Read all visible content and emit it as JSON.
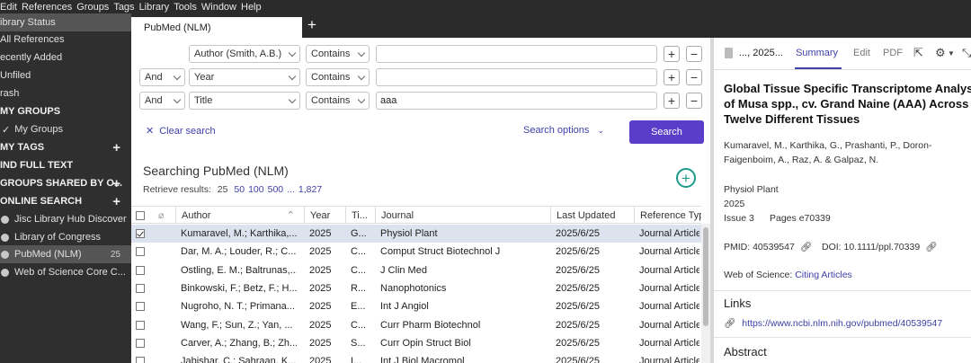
{
  "menu": [
    "Edit",
    "References",
    "Groups",
    "Tags",
    "Library",
    "Tools",
    "Window",
    "Help"
  ],
  "sidebar": {
    "items": [
      {
        "label": "Library Status",
        "display": "ibrary Status",
        "type": "item",
        "selected": true
      },
      {
        "label": "All References",
        "display": "All References",
        "type": "item"
      },
      {
        "label": "Recently Added",
        "display": "ecently Added",
        "type": "item"
      },
      {
        "label": "Unfiled",
        "display": "Unfiled",
        "type": "item"
      },
      {
        "label": "Trash",
        "display": "rash",
        "type": "item"
      },
      {
        "label": "MY GROUPS",
        "display": "MY GROUPS",
        "type": "header"
      },
      {
        "label": "My Groups",
        "display": "My Groups",
        "type": "subitem"
      },
      {
        "label": "MY TAGS",
        "display": "MY TAGS",
        "type": "header",
        "plus": true
      },
      {
        "label": "FIND FULL TEXT",
        "display": "IND FULL TEXT",
        "type": "header"
      },
      {
        "label": "GROUPS SHARED BY O...",
        "display": "GROUPS SHARED BY O...",
        "type": "header",
        "plus": true
      },
      {
        "label": "ONLINE SEARCH",
        "display": "ONLINE SEARCH",
        "type": "header",
        "plus": true
      },
      {
        "label": "Jisc Library Hub Discover",
        "display": "Jisc Library Hub Discover",
        "type": "online"
      },
      {
        "label": "Library of Congress",
        "display": "Library of Congress",
        "type": "online"
      },
      {
        "label": "PubMed (NLM)",
        "display": "PubMed (NLM)",
        "type": "online",
        "count": "25",
        "selected": true
      },
      {
        "label": "Web of Science Core C...",
        "display": "Web of Science Core C...",
        "type": "online"
      }
    ]
  },
  "tabs": {
    "active": "PubMed (NLM)",
    "add": "+"
  },
  "search": {
    "rows": [
      {
        "bool": "",
        "field": "Author (Smith, A.B.)",
        "op": "Contains",
        "value": ""
      },
      {
        "bool": "And",
        "field": "Year",
        "op": "Contains",
        "value": ""
      },
      {
        "bool": "And",
        "field": "Title",
        "op": "Contains",
        "value": "aaa"
      }
    ],
    "clear_label": "Clear search",
    "options_label": "Search options",
    "search_label": "Search"
  },
  "results": {
    "heading": "Searching PubMed (NLM)",
    "retrieve_label": "Retrieve results:",
    "current": "25",
    "options": [
      "50",
      "100",
      "500",
      "...",
      "1,827"
    ]
  },
  "table": {
    "columns": [
      "Author",
      "Year",
      "Ti...",
      "Journal",
      "Last Updated",
      "Reference Typ"
    ],
    "rows": [
      {
        "author": "Kumaravel, M.; Karthika,...",
        "year": "2025",
        "title": "G...",
        "journal": "Physiol Plant",
        "updated": "2025/6/25",
        "type": "Journal Article",
        "checked": true
      },
      {
        "author": "Dar, M. A.; Louder, R.; C...",
        "year": "2025",
        "title": "C...",
        "journal": "Comput Struct Biotechnol J",
        "updated": "2025/6/25",
        "type": "Journal Article"
      },
      {
        "author": "Ostling, E. M.; Baltrunas,...",
        "year": "2025",
        "title": "C...",
        "journal": "J Clin Med",
        "updated": "2025/6/25",
        "type": "Journal Article"
      },
      {
        "author": "Binkowski, F.; Betz, F.; H...",
        "year": "2025",
        "title": "R...",
        "journal": "Nanophotonics",
        "updated": "2025/6/25",
        "type": "Journal Article"
      },
      {
        "author": "Nugroho, N. T.; Primana...",
        "year": "2025",
        "title": "E...",
        "journal": "Int J Angiol",
        "updated": "2025/6/25",
        "type": "Journal Article"
      },
      {
        "author": "Wang, F.; Sun, Z.; Yan, ...",
        "year": "2025",
        "title": "C...",
        "journal": "Curr Pharm Biotechnol",
        "updated": "2025/6/25",
        "type": "Journal Article"
      },
      {
        "author": "Carver, A.; Zhang, B.; Zh...",
        "year": "2025",
        "title": "S...",
        "journal": "Curr Opin Struct Biol",
        "updated": "2025/6/25",
        "type": "Journal Article"
      },
      {
        "author": "Jabishar, C.; Sahraan, K...",
        "year": "2025",
        "title": "I...",
        "journal": "Int J Biol Macromol",
        "updated": "2025/6/25",
        "type": "Journal Article"
      }
    ]
  },
  "pane": {
    "title": "..., 2025...",
    "tabs": [
      "Summary",
      "Edit",
      "PDF"
    ],
    "article_title": "Global Tissue Specific Transcriptome Analysis\nof Musa spp., cv. Grand Naine (AAA) Across\nTwelve Different Tissues",
    "authors_line1": "Kumaravel, M., Karthika, G., Prashanti, P., Doron-",
    "authors_line2": "Faigenboim, A., Raz, A. & Galpaz, N.",
    "journal": "Physiol Plant",
    "year": "2025",
    "issue": "Issue 3",
    "pages": "Pages e70339",
    "pmid": "PMID: 40539547",
    "doi": "DOI: 10.1111/ppl.70339",
    "wos_label": "Web of Science:",
    "wos_link": "Citing Articles",
    "links_heading": "Links",
    "link_url": "https://www.ncbi.nlm.nih.gov/pubmed/40539547",
    "abstract_heading": "Abstract"
  },
  "colors": {
    "accent": "#5a3dc8",
    "link": "#3f3fa8",
    "sidebar": "#2f2f2f",
    "add_circle": "#1e9a8a"
  }
}
